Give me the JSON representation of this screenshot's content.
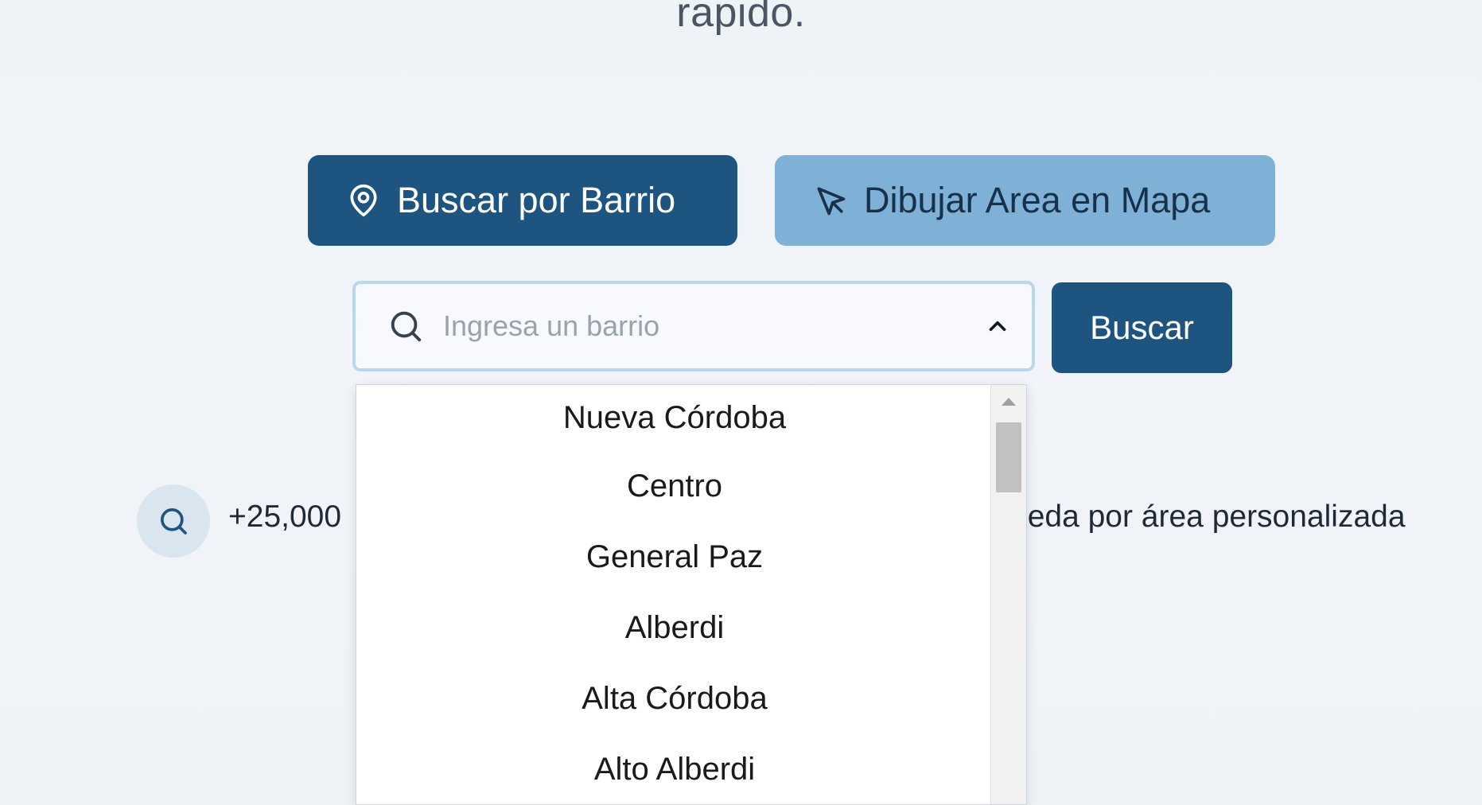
{
  "hero": {
    "title_tail": "rapido."
  },
  "modes": {
    "barrio_label": "Buscar por Barrio",
    "mapa_label": "Dibujar Area en Mapa"
  },
  "search": {
    "placeholder": "Ingresa un barrio",
    "value": "",
    "submit_label": "Buscar"
  },
  "features": {
    "left_text": "+25,000",
    "right_text": "ueda por área personalizada"
  },
  "dropdown": {
    "options": [
      "Nueva Córdoba",
      "Centro",
      "General Paz",
      "Alberdi",
      "Alta Córdoba",
      "Alto Alberdi"
    ]
  },
  "colors": {
    "primary": "#1e5480",
    "secondary": "#7fb0d6",
    "input_focus_border": "#b9d7ef"
  },
  "icons": {
    "barrio": "map-pin-icon",
    "mapa": "cursor-arrow-icon",
    "search": "search-icon",
    "chevron": "chevron-up-icon",
    "feature": "search-icon"
  }
}
